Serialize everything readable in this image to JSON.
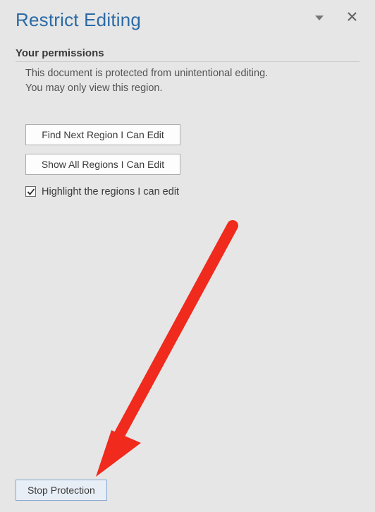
{
  "header": {
    "title": "Restrict Editing"
  },
  "section": {
    "heading": "Your permissions",
    "info_line1": "This document is protected from unintentional editing.",
    "info_line2": "You may only view this region."
  },
  "buttons": {
    "find_next": "Find Next Region I Can Edit",
    "show_all": "Show All Regions I Can Edit"
  },
  "checkbox": {
    "highlight_label": "Highlight the regions I can edit",
    "highlight_checked": true
  },
  "footer": {
    "stop_protection": "Stop Protection"
  },
  "colors": {
    "accent": "#2b6aa5",
    "annotation": "#f02a1d"
  }
}
